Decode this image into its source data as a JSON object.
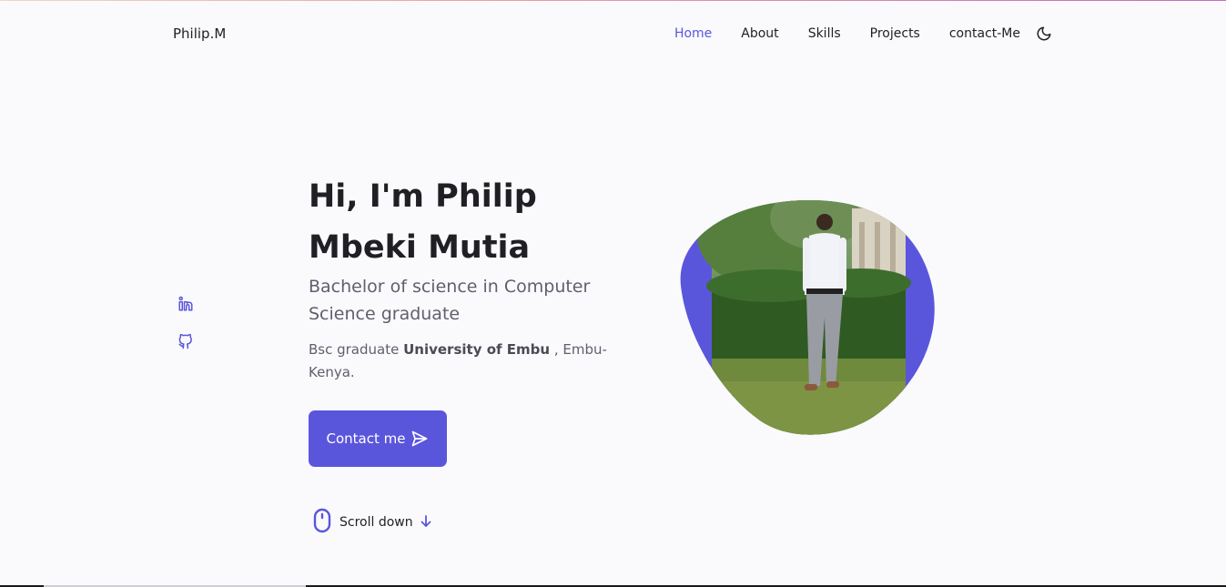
{
  "header": {
    "logo": "Philip.M",
    "nav": [
      {
        "label": "Home",
        "active": true
      },
      {
        "label": "About",
        "active": false
      },
      {
        "label": "Skills",
        "active": false
      },
      {
        "label": "Projects",
        "active": false
      },
      {
        "label": "contact-Me",
        "active": false
      }
    ],
    "theme_icon": "moon-icon"
  },
  "socials": [
    {
      "icon": "linkedin-icon"
    },
    {
      "icon": "github-icon"
    }
  ],
  "hero": {
    "title_line1": "Hi, I'm Philip",
    "title_line2": "Mbeki Mutia",
    "subtitle": "Bachelor of science in Computer Science graduate",
    "desc_prefix": "Bsc graduate ",
    "desc_bold": "University of Embu",
    "desc_suffix": " , Embu-Kenya.",
    "contact_label": "Contact me",
    "contact_icon": "send-icon",
    "scroll_label": "Scroll down",
    "scroll_icon": "mouse-icon",
    "scroll_arrow_icon": "arrow-down-icon"
  },
  "colors": {
    "accent": "#5a56dc",
    "text": "#1f1f24",
    "muted": "#5f5f6e",
    "background": "#fafafd"
  }
}
